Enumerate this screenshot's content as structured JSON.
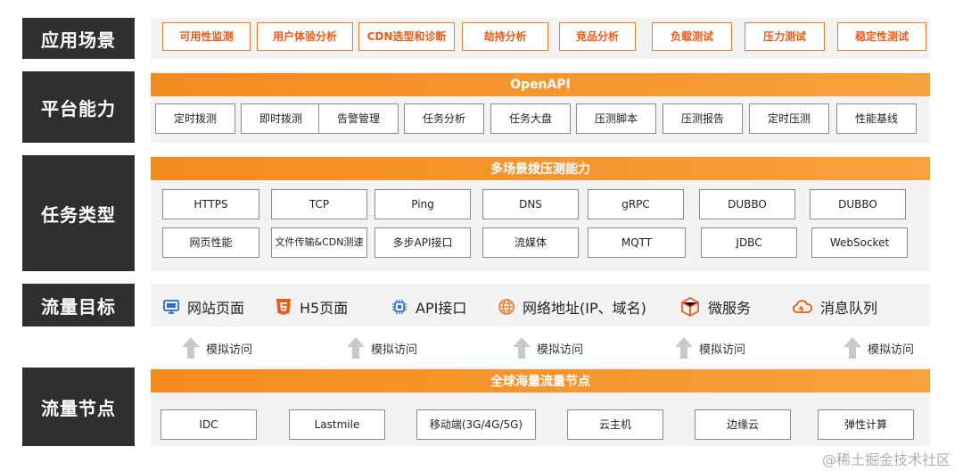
{
  "rows": {
    "scenarios": "应用场景",
    "platform": "平台能力",
    "tasks": "任务类型",
    "targets": "流量目标",
    "nodes": "流量节点"
  },
  "scenarios": [
    "可用性监测",
    "用户体验分析",
    "CDN选型和诊断",
    "劫持分析",
    "竞品分析",
    "负载测试",
    "压力测试",
    "稳定性测试"
  ],
  "platform": {
    "bar": "OpenAPI",
    "items": [
      "定时拨测",
      "即时拨测",
      "告警管理",
      "任务分析",
      "任务大盘",
      "压测脚本",
      "压测报告",
      "定时压测",
      "性能基线"
    ]
  },
  "tasks": {
    "bar": "多场景拨压测能力",
    "row1": [
      "HTTPS",
      "TCP",
      "Ping",
      "DNS",
      "gRPC",
      "DUBBO",
      "DUBBO"
    ],
    "row2": [
      "网页性能",
      "文件传输&CDN测速",
      "多步API接口",
      "流媒体",
      "MQTT",
      "JDBC",
      "WebSocket"
    ]
  },
  "targets": [
    {
      "label": "网站页面",
      "icon": "monitor-icon"
    },
    {
      "label": "H5页面",
      "icon": "html5-icon"
    },
    {
      "label": "API接口",
      "icon": "chip-icon"
    },
    {
      "label": "网络地址(IP、域名)",
      "icon": "globe-icon"
    },
    {
      "label": "微服务",
      "icon": "cube-icon"
    },
    {
      "label": "消息队列",
      "icon": "cloud-icon"
    }
  ],
  "access_label": "模拟访问",
  "nodes": {
    "bar": "全球海量流量节点",
    "items": [
      "IDC",
      "Lastmile",
      "移动端(3G/4G/5G)",
      "云主机",
      "边缘云",
      "弹性计算"
    ]
  },
  "watermark": "@稀土掘金技术社区",
  "colors": {
    "accent": "#f58a1f",
    "label_bg": "#2f2f2f",
    "scene_text": "#f05a14"
  }
}
